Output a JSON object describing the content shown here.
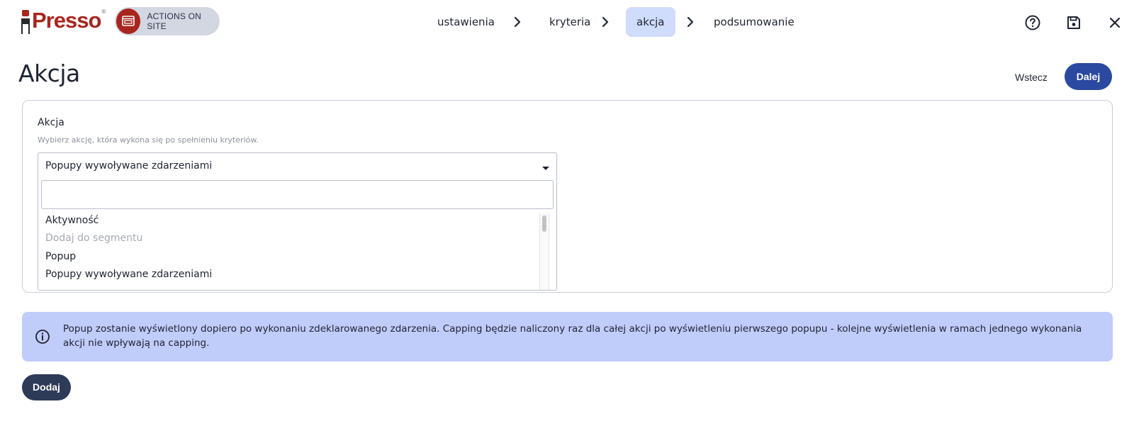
{
  "brand": {
    "logo_text": "Presso",
    "registered_mark": "®",
    "product_label": "ACTIONS ON SITE",
    "brand_color": "#a8261d"
  },
  "steps": [
    {
      "label": "ustawienia",
      "active": false
    },
    {
      "label": "kryteria",
      "active": false
    },
    {
      "label": "akcja",
      "active": true
    },
    {
      "label": "podsumowanie",
      "active": false
    }
  ],
  "toolbar": {
    "help_icon": "help-circle-icon",
    "save_icon": "save-icon",
    "close_icon": "close-icon"
  },
  "header": {
    "title": "Akcja",
    "back_label": "Wstecz",
    "next_label": "Dalej"
  },
  "form": {
    "label": "Akcja",
    "help": "Wybierz akcję, która wykona się po spełnieniu kryteriów.",
    "selected_value": "Popupy wywoływane zdarzeniami",
    "search_value": "",
    "options": [
      {
        "label": "Aktywność",
        "disabled": false
      },
      {
        "label": "Dodaj do segmentu",
        "disabled": true
      },
      {
        "label": "Popup",
        "disabled": false
      },
      {
        "label": "Popupy wywoływane zdarzeniami",
        "disabled": false
      }
    ]
  },
  "info": {
    "text": "Popup zostanie wyświetlony dopiero po wykonaniu zdeklarowanego zdarzenia. Capping będzie naliczony raz dla całej akcji po wyświetleniu pierwszego popupu - kolejne wyświetlenia w ramach jednego wykonania akcji nie wpływają na capping."
  },
  "actions": {
    "add_label": "Dodaj"
  },
  "colors": {
    "primary": "#2b49a0",
    "active_step_bg": "#cfdcfb",
    "info_bg": "#c0ccfa",
    "secondary_button": "#2d3b58"
  }
}
